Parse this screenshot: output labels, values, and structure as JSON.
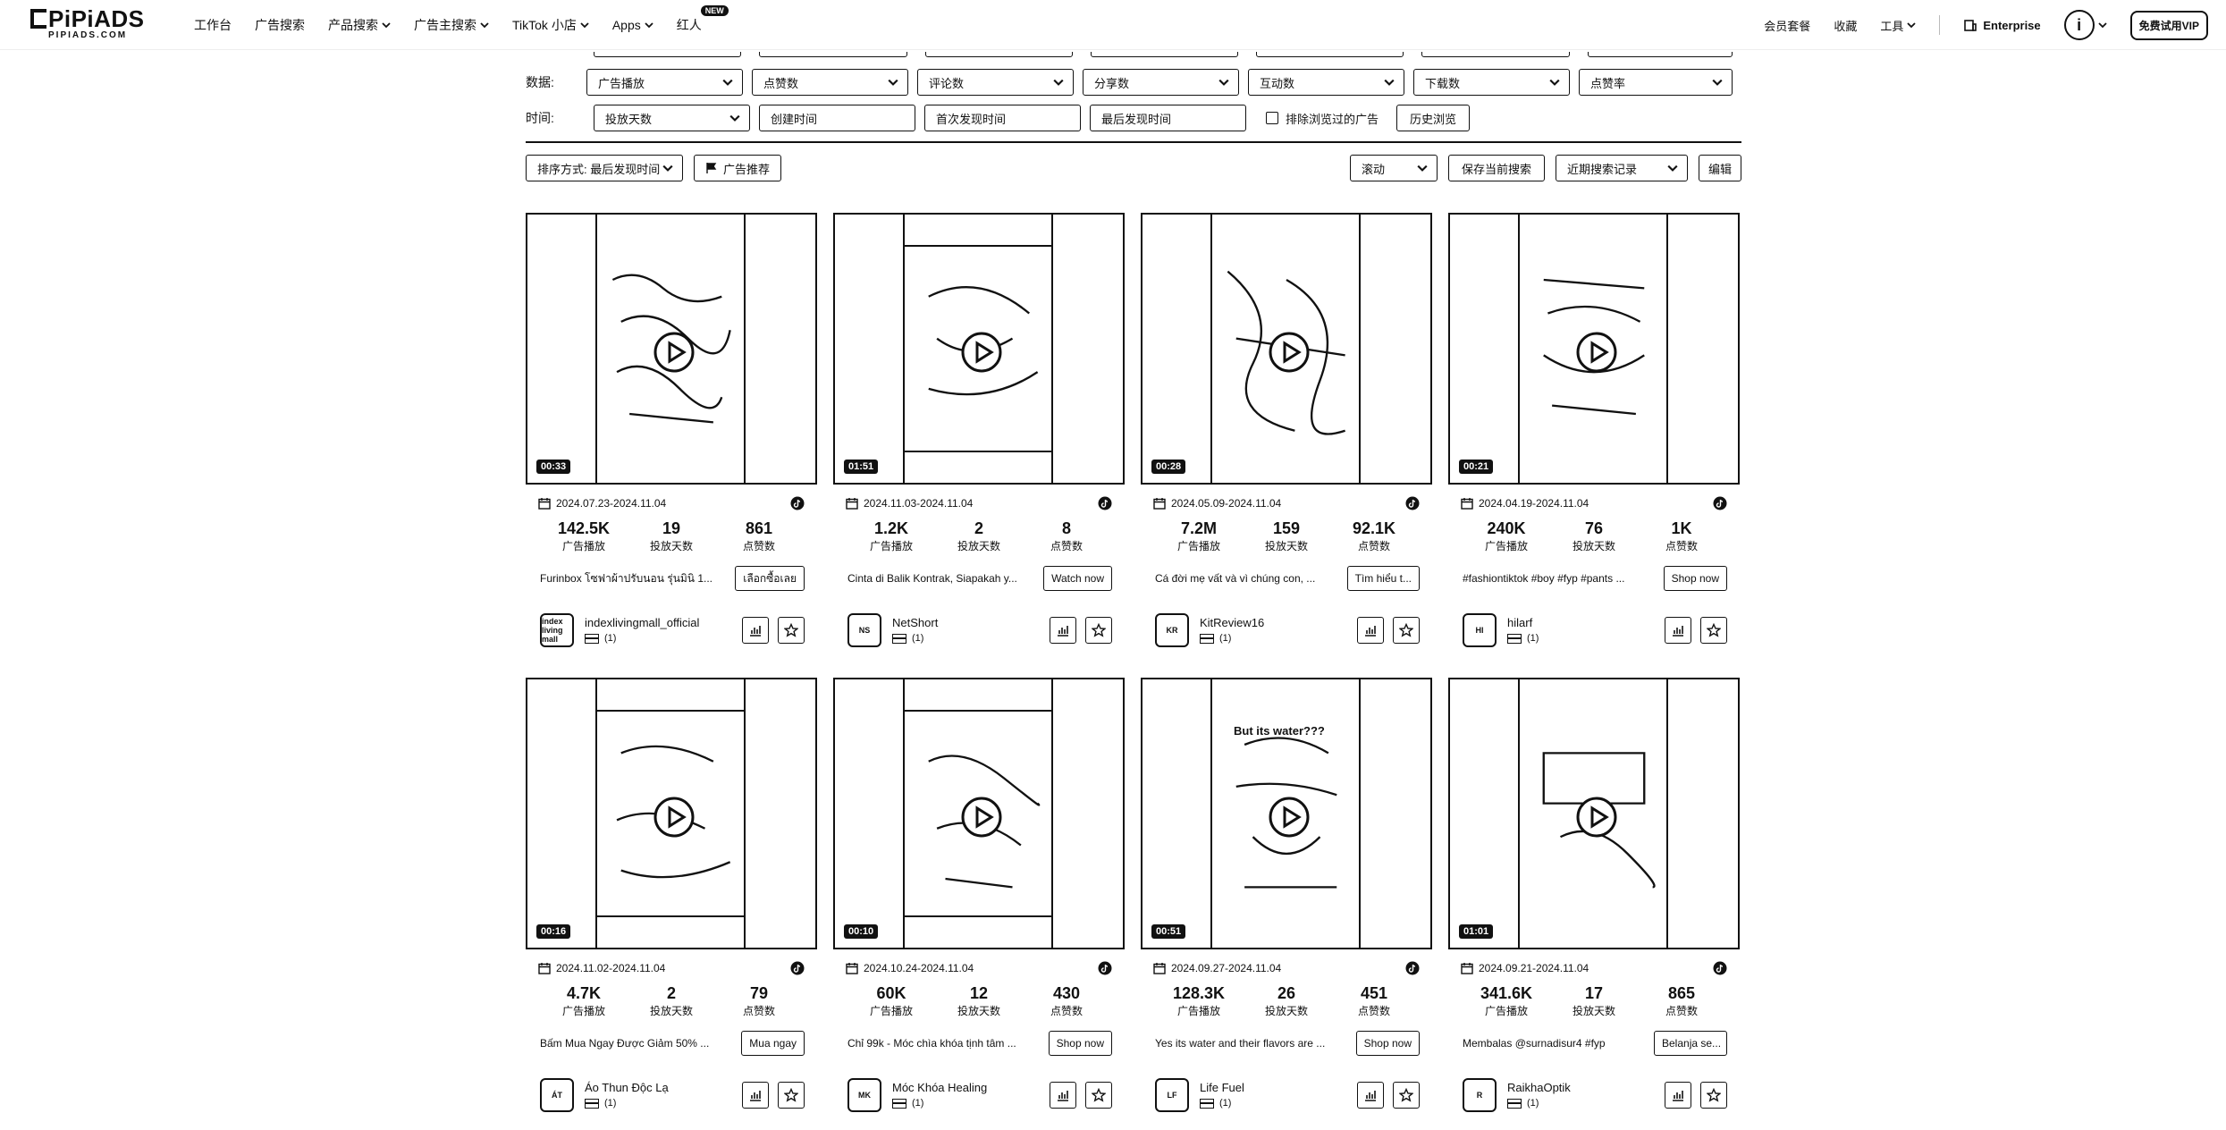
{
  "nav": {
    "logo": "PiPiADS",
    "logo_sub": "PIPIADS.COM",
    "items": [
      {
        "label": "工作台",
        "dropdown": false
      },
      {
        "label": "广告搜索",
        "dropdown": false
      },
      {
        "label": "产品搜索",
        "dropdown": true
      },
      {
        "label": "广告主搜索",
        "dropdown": true
      },
      {
        "label": "TikTok 小店",
        "dropdown": true
      },
      {
        "label": "Apps",
        "dropdown": true
      },
      {
        "label": "红人",
        "dropdown": false
      }
    ],
    "new_badge": "NEW",
    "right": {
      "plans": "会员套餐",
      "favorites": "收藏",
      "tools": "工具",
      "enterprise": "Enterprise",
      "avatar_letter": "i",
      "vip": "免费试用VIP"
    }
  },
  "filters": {
    "data_label": "数据:",
    "data_selects": [
      "广告播放",
      "点赞数",
      "评论数",
      "分享数",
      "互动数",
      "下载数",
      "点赞率"
    ],
    "time_label": "时间:",
    "time_select": "投放天数",
    "time_inputs": [
      "创建时间",
      "首次发现时间",
      "最后发现时间"
    ],
    "exclude_label": "排除浏览过的广告",
    "history_button": "历史浏览"
  },
  "toolbar": {
    "sort": "排序方式: 最后发现时间",
    "recommend": "广告推荐",
    "scroll": "滚动",
    "save_search": "保存当前搜索",
    "recent": "近期搜索记录",
    "edit": "编辑"
  },
  "stat_labels": [
    "广告播放",
    "投放天数",
    "点赞数"
  ],
  "cards": [
    {
      "duration": "00:33",
      "dates": "2024.07.23-2024.11.04",
      "plays": "142.5K",
      "days": "19",
      "likes": "861",
      "desc": "Furinbox โซฟาผ้าปรับนอน รุ่นมินิ 1...",
      "cta": "เลือกซื้อเลย",
      "advertiser": "indexlivingmall_official",
      "count": "(1)",
      "avatar_text": "index living mall"
    },
    {
      "duration": "01:51",
      "dates": "2024.11.03-2024.11.04",
      "plays": "1.2K",
      "days": "2",
      "likes": "8",
      "desc": "Cinta di Balik Kontrak, Siapakah y...",
      "cta": "Watch now",
      "advertiser": "NetShort",
      "count": "(1)",
      "avatar_text": "NS"
    },
    {
      "duration": "00:28",
      "dates": "2024.05.09-2024.11.04",
      "plays": "7.2M",
      "days": "159",
      "likes": "92.1K",
      "desc": "Cá đời mẹ vất và vì chúng con, ...",
      "cta": "Tìm hiểu t...",
      "advertiser": "KitReview16",
      "count": "(1)",
      "avatar_text": "KR"
    },
    {
      "duration": "00:21",
      "dates": "2024.04.19-2024.11.04",
      "plays": "240K",
      "days": "76",
      "likes": "1K",
      "desc": "#fashiontiktok #boy #fyp #pants ...",
      "cta": "Shop now",
      "advertiser": "hilarf",
      "count": "(1)",
      "avatar_text": "HI"
    },
    {
      "duration": "00:16",
      "dates": "2024.11.02-2024.11.04",
      "plays": "4.7K",
      "days": "2",
      "likes": "79",
      "desc": "Bấm Mua Ngay Được Giảm 50% ...",
      "cta": "Mua ngay",
      "advertiser": "Áo Thun Độc Lạ",
      "count": "(1)",
      "avatar_text": "ÁT"
    },
    {
      "duration": "00:10",
      "dates": "2024.10.24-2024.11.04",
      "plays": "60K",
      "days": "12",
      "likes": "430",
      "desc": "Chỉ 99k - Móc chìa khóa tịnh tâm ...",
      "cta": "Shop now",
      "advertiser": "Móc Khóa Healing",
      "count": "(1)",
      "avatar_text": "MK"
    },
    {
      "duration": "00:51",
      "dates": "2024.09.27-2024.11.04",
      "plays": "128.3K",
      "days": "26",
      "likes": "451",
      "desc": "Yes its water and their flavors are ...",
      "cta": "Shop now",
      "advertiser": "Life Fuel",
      "count": "(1)",
      "avatar_text": "LF",
      "overlay": "But its water???"
    },
    {
      "duration": "01:01",
      "dates": "2024.09.21-2024.11.04",
      "plays": "341.6K",
      "days": "17",
      "likes": "865",
      "desc": "Membalas @surnadisur4 #fyp",
      "cta": "Belanja se...",
      "advertiser": "RaikhaOptik",
      "count": "(1)",
      "avatar_text": "R"
    }
  ]
}
